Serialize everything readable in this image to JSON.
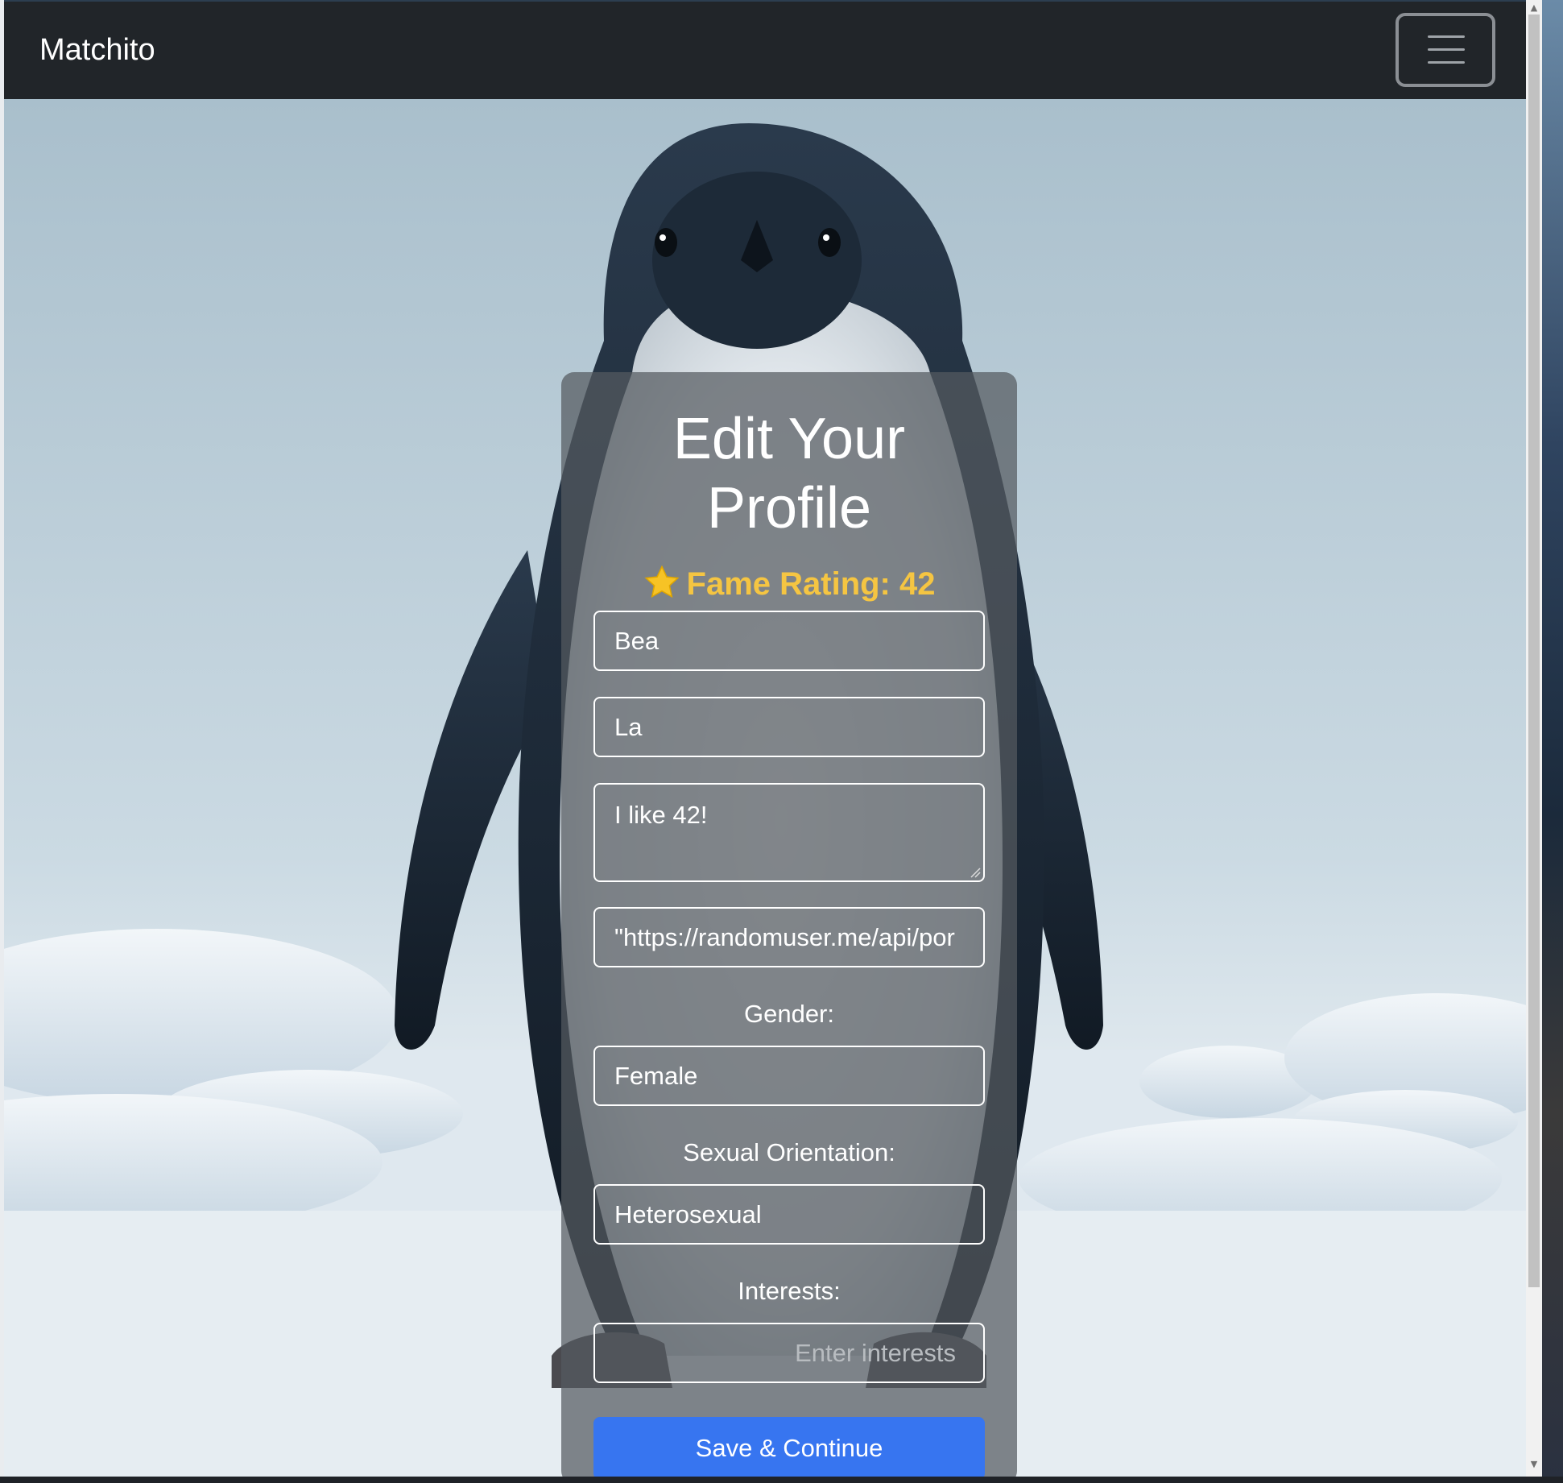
{
  "navbar": {
    "brand": "Matchito",
    "menu_icon": "hamburger-icon"
  },
  "form": {
    "title_line1": "Edit Your",
    "title_line2": "Profile",
    "fame_label": "Fame Rating: 42",
    "fame_icon": "star-icon",
    "first_name_value": "Bea",
    "last_name_value": "La",
    "bio_value": "I like 42!",
    "photo_url_value": "\"https://randomuser.me/api/por",
    "gender_label": "Gender:",
    "gender_value": "Female",
    "orientation_label": "Sexual Orientation:",
    "orientation_value": "Heterosexual",
    "interests_label": "Interests:",
    "interests_placeholder": "Enter interests",
    "save_label": "Save & Continue"
  },
  "colors": {
    "navbar_bg": "#212529",
    "fame": "#f5c542",
    "primary_button": "#3775f0"
  }
}
